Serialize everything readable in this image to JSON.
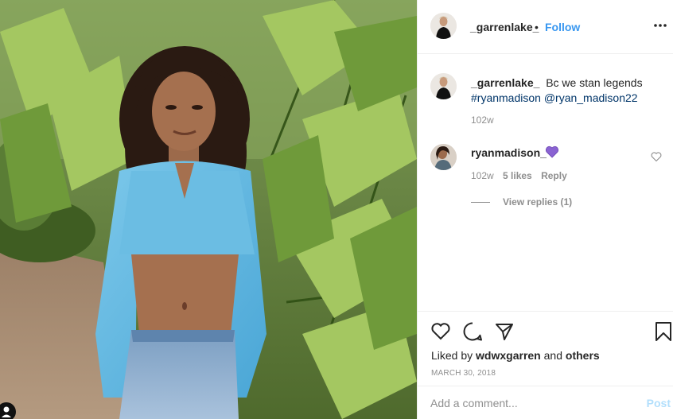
{
  "post": {
    "header": {
      "username": "_garrenlake_",
      "separator": "•",
      "follow_label": "Follow",
      "more_icon": "more-options-icon"
    },
    "caption": {
      "username": "_garrenlake_",
      "text": "Bc we stan legends",
      "hashtag": "#ryanmadison",
      "mention": "@ryan_madison22",
      "time": "102w"
    },
    "comment": {
      "username": "ryanmadison_",
      "emoji_icon": "purple-heart-icon",
      "time": "102w",
      "likes": "5 likes",
      "reply_label": "Reply",
      "view_replies": "View replies (1)"
    },
    "actions": {
      "icons": [
        "heart-icon",
        "comment-icon",
        "share-icon",
        "bookmark-icon"
      ],
      "liked_by_prefix": "Liked by",
      "liked_by_user": "wdwxgarren",
      "liked_by_and": "and",
      "liked_by_others": "others",
      "date": "MARCH 30, 2018"
    },
    "add_comment": {
      "placeholder": "Add a comment...",
      "post_label": "Post"
    }
  },
  "colors": {
    "link_blue": "#3897f0",
    "hashtag_blue": "#003569",
    "muted_gray": "#8e8e8e",
    "post_disabled": "#b2dffc",
    "emoji_purple": "#8a63d2"
  }
}
